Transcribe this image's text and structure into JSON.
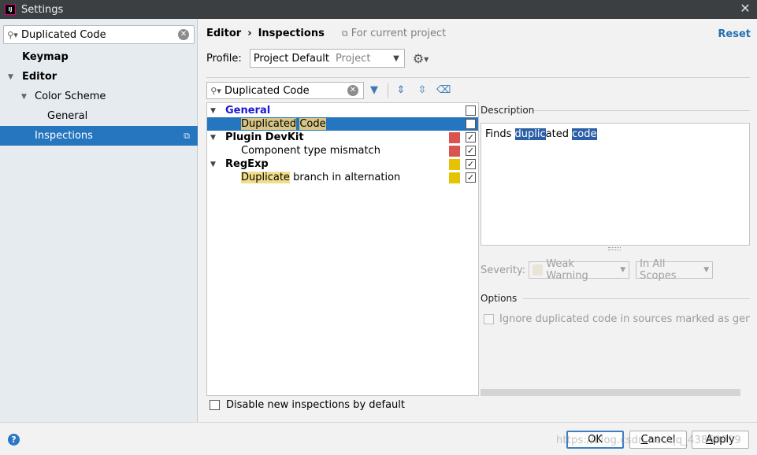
{
  "window": {
    "title": "Settings",
    "app_icon_text": "IJ"
  },
  "left": {
    "search_value": "Duplicated Code",
    "tree": [
      {
        "label": "Keymap"
      },
      {
        "label": "Editor"
      },
      {
        "label": "Color Scheme"
      },
      {
        "label": "General"
      },
      {
        "label": "Inspections"
      }
    ]
  },
  "header": {
    "crumb1": "Editor",
    "crumb_sep": "›",
    "crumb2": "Inspections",
    "scope": "For current project",
    "reset": "Reset"
  },
  "profile": {
    "label": "Profile:",
    "value": "Project Default",
    "sub": "Project"
  },
  "filter": {
    "value": "Duplicated Code"
  },
  "inspections": {
    "general": "General",
    "dup_a": "Duplicated",
    "dup_b": "Code",
    "plugin_devkit": "Plugin DevKit",
    "component_mismatch": "Component type mismatch",
    "regexp": "RegExp",
    "dup_branch_hl": "Duplicate",
    "dup_branch_rest": "branch in alternation",
    "colors": {
      "error": "#d9534f",
      "warning": "#e5c300",
      "selection": "#2675bf"
    }
  },
  "disable_new": "Disable new inspections by default",
  "description": {
    "title": "Description",
    "t1": "Finds ",
    "t2": "duplic",
    "t3": "ated",
    "t4": "code"
  },
  "severity": {
    "label": "Severity:",
    "value": "Weak Warning",
    "scope": "In All Scopes"
  },
  "options": {
    "title": "Options",
    "ignore": "Ignore duplicated code in sources marked as generated"
  },
  "footer": {
    "help": "?",
    "ok": "OK",
    "cancel_pre": "",
    "cancel_u": "C",
    "cancel_rest": "ancel",
    "apply_pre": "",
    "apply_u": "A",
    "apply_rest": "pply",
    "watermark": "https://blog.csdn.net/qq_43859999"
  }
}
